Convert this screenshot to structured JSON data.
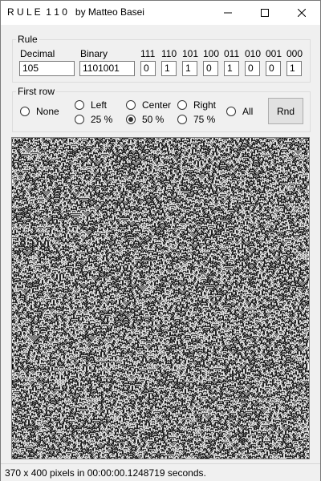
{
  "window": {
    "title": "R U L E  1 1 0   by Matteo Basei"
  },
  "rule_group": {
    "label": "Rule",
    "decimal_label": "Decimal",
    "decimal_value": "105",
    "binary_label": "Binary",
    "binary_value": "1101001",
    "patterns": [
      {
        "label": "111",
        "value": "0"
      },
      {
        "label": "110",
        "value": "1"
      },
      {
        "label": "101",
        "value": "1"
      },
      {
        "label": "100",
        "value": "0"
      },
      {
        "label": "011",
        "value": "1"
      },
      {
        "label": "010",
        "value": "0"
      },
      {
        "label": "001",
        "value": "0"
      },
      {
        "label": "000",
        "value": "1"
      }
    ]
  },
  "first_row_group": {
    "label": "First row",
    "options": [
      {
        "label": "None",
        "checked": false
      },
      {
        "label": "Left",
        "checked": false
      },
      {
        "label": "25 %",
        "checked": false
      },
      {
        "label": "Center",
        "checked": false
      },
      {
        "label": "50 %",
        "checked": true
      },
      {
        "label": "Right",
        "checked": false
      },
      {
        "label": "75 %",
        "checked": false
      },
      {
        "label": "All",
        "checked": false
      }
    ],
    "rnd_label": "Rnd"
  },
  "status": {
    "text": "370 x 400 pixels in 00:00:00.1248719 seconds."
  }
}
